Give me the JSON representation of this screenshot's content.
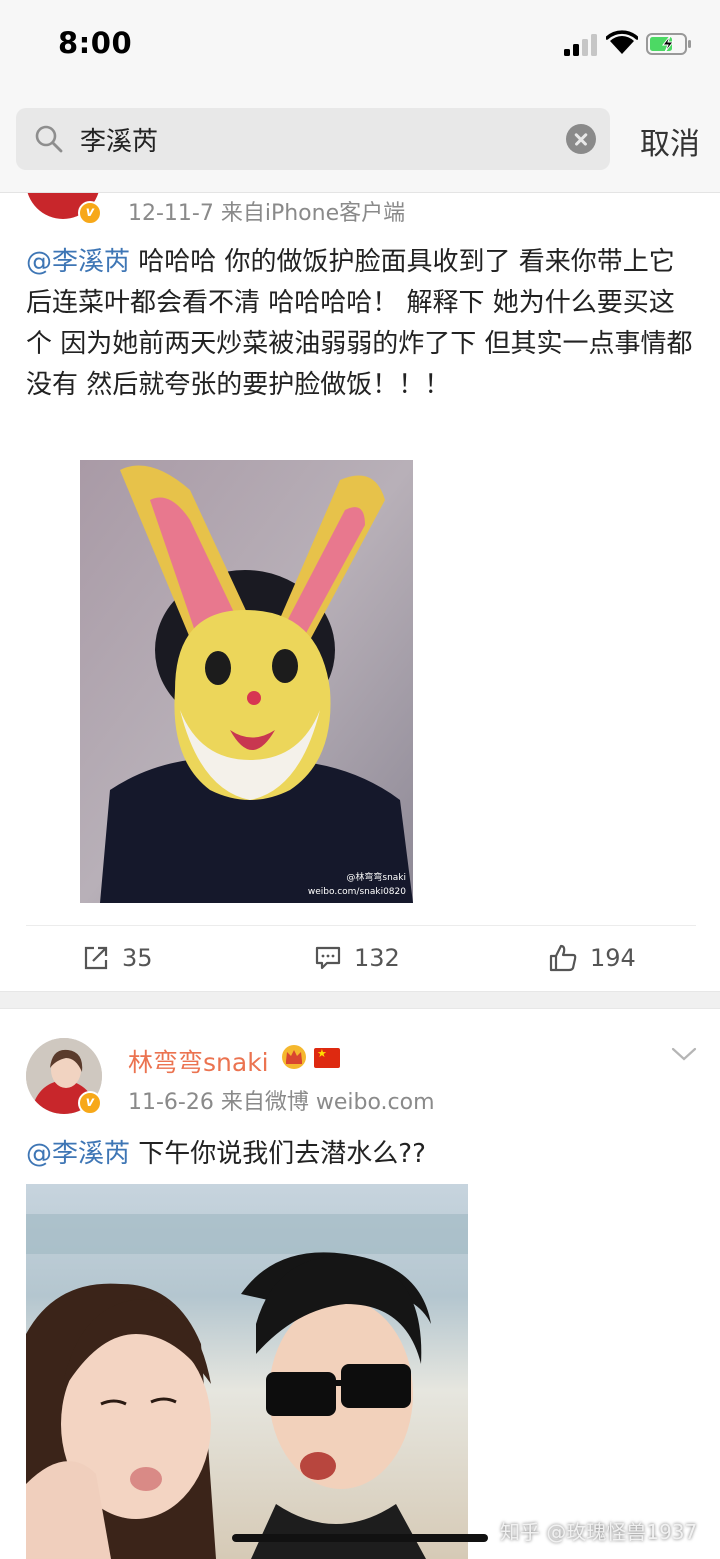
{
  "status_bar": {
    "time": "8:00"
  },
  "search": {
    "query": "李溪芮",
    "cancel_label": "取消"
  },
  "post1": {
    "meta": "12-11-7  来自iPhone客户端",
    "mention": "@李溪芮",
    "text": " 哈哈哈 你的做饭护脸面具收到了 看来你带上它后连菜叶都会看不清 哈哈哈哈！  解释下 她为什么要买这个 因为她前两天炒菜被油弱弱的炸了下 但其实一点事情都没有 然后就夸张的要护脸做饭！！！",
    "watermark_line1": "@林弯弯snaki",
    "watermark_line2": "weibo.com/snaki0820",
    "repost_count": "35",
    "comment_count": "132",
    "like_count": "194"
  },
  "post2": {
    "username": "林弯弯snaki",
    "meta": "11-6-26  来自微博 weibo.com",
    "mention": "@李溪芮",
    "text": "  下午你说我们去潜水么??"
  },
  "verified_badge": "v",
  "credit": "知乎 @玫瑰怪兽1937",
  "colors": {
    "mention": "#3e76b5",
    "username": "#eb7350",
    "verified": "#f7a819",
    "meta": "#8a8a8a"
  }
}
